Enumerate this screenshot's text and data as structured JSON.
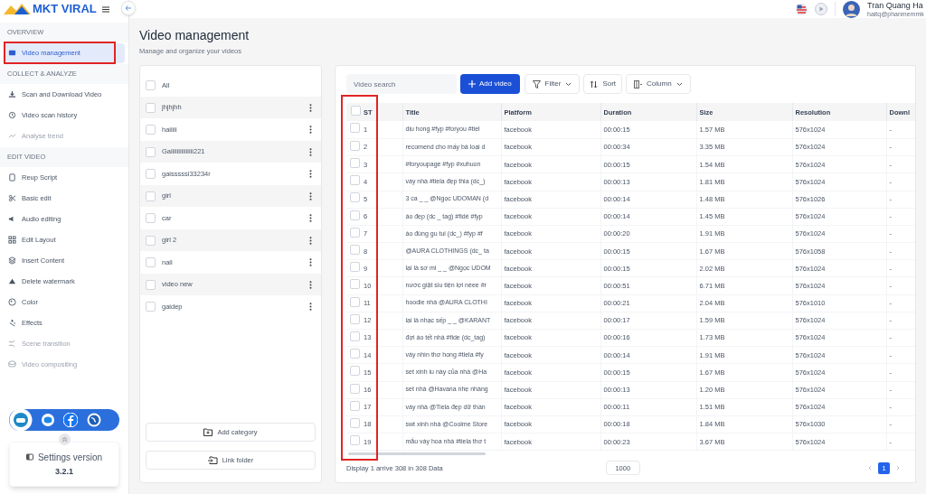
{
  "app": {
    "logo": "MKT VIRAL"
  },
  "user": {
    "name": "Tran Quang Ha",
    "email": "haitq@phanmemmk"
  },
  "sidebar": {
    "sections": [
      {
        "title": "OVERVIEW",
        "items": [
          {
            "label": "Video management",
            "selected": true,
            "disabled": false,
            "highlighted": true
          }
        ]
      },
      {
        "title": "COLLECT & ANALYZE",
        "items": [
          {
            "label": "Scan and Download Video",
            "selected": false,
            "disabled": false,
            "highlighted": false
          },
          {
            "label": "Video scan history",
            "selected": false,
            "disabled": false,
            "highlighted": false
          },
          {
            "label": "Analyse trend",
            "selected": false,
            "disabled": true,
            "highlighted": false
          }
        ]
      },
      {
        "title": "EDIT VIDEO",
        "items": [
          {
            "label": "Reup Script",
            "selected": false,
            "disabled": false,
            "highlighted": false
          },
          {
            "label": "Basic edit",
            "selected": false,
            "disabled": false,
            "highlighted": false
          },
          {
            "label": "Audio editing",
            "selected": false,
            "disabled": false,
            "highlighted": false
          },
          {
            "label": "Edit Layout",
            "selected": false,
            "disabled": false,
            "highlighted": false
          },
          {
            "label": "Insert Content",
            "selected": false,
            "disabled": false,
            "highlighted": false
          },
          {
            "label": "Delete watermark",
            "selected": false,
            "disabled": false,
            "highlighted": false
          },
          {
            "label": "Color",
            "selected": false,
            "disabled": false,
            "highlighted": false
          },
          {
            "label": "Effects",
            "selected": false,
            "disabled": false,
            "highlighted": false
          },
          {
            "label": "Scene transition",
            "selected": false,
            "disabled": true,
            "highlighted": false
          },
          {
            "label": "Video compositing",
            "selected": false,
            "disabled": true,
            "highlighted": false
          }
        ]
      }
    ]
  },
  "version_card": {
    "label": "Settings version",
    "version": "3.2.1"
  },
  "page": {
    "title": "Video management",
    "subtitle": "Manage and organize your videos"
  },
  "categories": {
    "items": [
      {
        "kind": "all",
        "label": "All",
        "checked": false
      },
      {
        "kind": "category",
        "label": "jhjhjhh",
        "checked": false
      },
      {
        "kind": "category",
        "label": "haiiiii",
        "checked": false
      },
      {
        "kind": "category",
        "label": "Gaiiiiiiiiiiiiiii221",
        "checked": false
      },
      {
        "kind": "category",
        "label": "gaisssssi33234r",
        "checked": false
      },
      {
        "kind": "category",
        "label": "girl",
        "checked": false
      },
      {
        "kind": "category",
        "label": "car",
        "checked": false
      },
      {
        "kind": "category",
        "label": "girl 2",
        "checked": false
      },
      {
        "kind": "category",
        "label": "nail",
        "checked": false
      },
      {
        "kind": "category",
        "label": "video new",
        "checked": false
      },
      {
        "kind": "category",
        "label": "gaidep",
        "checked": false
      }
    ],
    "buttons": [
      "Add category",
      "Link folder"
    ]
  },
  "toolbar": {
    "search_placeholder": "Video search",
    "add_button": "Add video",
    "filter": "Filter",
    "sort": "Sort",
    "column": "Column"
  },
  "table": {
    "columns": [
      "ST",
      "Title",
      "Platform",
      "Duration",
      "Size",
      "Resolution",
      "Downl"
    ],
    "select_all_checked": false,
    "checkbox_column_highlighted": true,
    "rows": [
      {
        "checked": false,
        "cells": [
          "1",
          "dịu hong #fyp #foryou #tiel",
          "facebook",
          "00:00:15",
          "1.57 MB",
          "576x1024",
          "-"
        ]
      },
      {
        "checked": false,
        "cells": [
          "2",
          "recomend cho mấy bà loại d",
          "facebook",
          "00:00:34",
          "3.35 MB",
          "576x1024",
          "-"
        ]
      },
      {
        "checked": false,
        "cells": [
          "3",
          "#foryoupage #fyp #xuhuon",
          "facebook",
          "00:00:15",
          "1.54 MB",
          "576x1024",
          "-"
        ]
      },
      {
        "checked": false,
        "cells": [
          "4",
          "váy nhà #tiela đẹp thia (dc_)",
          "facebook",
          "00:00:13",
          "1.81 MB",
          "576x1024",
          "-"
        ]
      },
      {
        "checked": false,
        "cells": [
          "5",
          "3 ca _ _ @Ngọc UDOMAN (d",
          "facebook",
          "00:00:14",
          "1.48 MB",
          "576x1026",
          "-"
        ]
      },
      {
        "checked": false,
        "cells": [
          "6",
          "áo đẹp (dc _ tag) #fidé #fyp",
          "facebook",
          "00:00:14",
          "1.45 MB",
          "576x1024",
          "-"
        ]
      },
      {
        "checked": false,
        "cells": [
          "7",
          "áo đúng gu tui (dc_) #fyp #f",
          "facebook",
          "00:00:20",
          "1.91 MB",
          "576x1024",
          "-"
        ]
      },
      {
        "checked": false,
        "cells": [
          "8",
          "@AURA CLOTHINGS (dc_ ta",
          "facebook",
          "00:00:15",
          "1.67 MB",
          "576x1058",
          "-"
        ]
      },
      {
        "checked": false,
        "cells": [
          "9",
          "lại là sơ mi _ _ @Ngọc UDOM",
          "facebook",
          "00:00:15",
          "2.02 MB",
          "576x1024",
          "-"
        ]
      },
      {
        "checked": false,
        "cells": [
          "10",
          "nước giặt siu tiện lợi nèee #r",
          "facebook",
          "00:00:51",
          "6.71 MB",
          "576x1024",
          "-"
        ]
      },
      {
        "checked": false,
        "cells": [
          "11",
          "hoodie nhà @AURA CLOTHI",
          "facebook",
          "00:00:21",
          "2.04 MB",
          "576x1010",
          "-"
        ]
      },
      {
        "checked": false,
        "cells": [
          "12",
          "lại là nhạc sếp _ _ @KARANT",
          "facebook",
          "00:00:17",
          "1.59 MB",
          "576x1024",
          "-"
        ]
      },
      {
        "checked": false,
        "cells": [
          "13",
          "đợi áo tết nhà #fide (dc_tag)",
          "facebook",
          "00:00:16",
          "1.73 MB",
          "576x1024",
          "-"
        ]
      },
      {
        "checked": false,
        "cells": [
          "14",
          "váy nhìn thơ hong #tiela #fy",
          "facebook",
          "00:00:14",
          "1.91 MB",
          "576x1024",
          "-"
        ]
      },
      {
        "checked": false,
        "cells": [
          "15",
          "set xinh iu này của nhà @Ha",
          "facebook",
          "00:00:15",
          "1.67 MB",
          "576x1024",
          "-"
        ]
      },
      {
        "checked": false,
        "cells": [
          "16",
          "set nhà @Havana nhẹ nhàng",
          "facebook",
          "00:00:13",
          "1.20 MB",
          "576x1024",
          "-"
        ]
      },
      {
        "checked": false,
        "cells": [
          "17",
          "váy nhà @Tiela đẹp dữ thần",
          "facebook",
          "00:00:11",
          "1.51 MB",
          "576x1024",
          "-"
        ]
      },
      {
        "checked": false,
        "cells": [
          "18",
          "swt xinh nhà @Coolme Store",
          "facebook",
          "00:00:18",
          "1.84 MB",
          "576x1030",
          "-"
        ]
      },
      {
        "checked": false,
        "cells": [
          "19",
          "mẫu váy hoa nhà #tiela thơ t",
          "facebook",
          "00:00:23",
          "3.67 MB",
          "576x1024",
          "-"
        ]
      }
    ]
  },
  "footer": {
    "summary": "Display 1 arrive 308 in 308 Data",
    "page_size": "1000",
    "pages": [
      {
        "label": "1",
        "selected": true
      }
    ]
  }
}
